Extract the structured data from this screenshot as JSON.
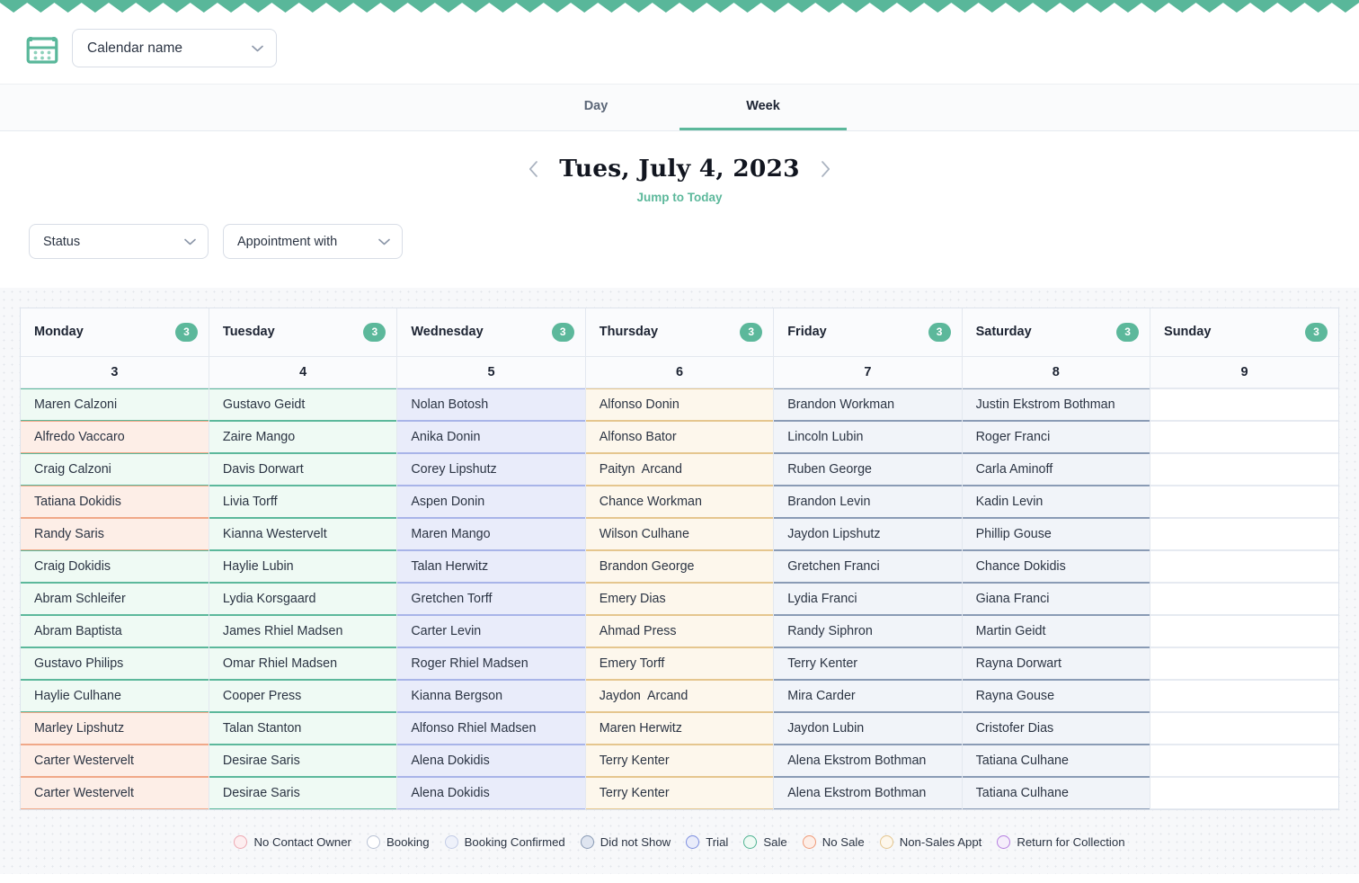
{
  "header": {
    "calendar_icon": "calendar-icon",
    "calendar_select_value": "Calendar name"
  },
  "tabs": [
    {
      "label": "Day",
      "active": false
    },
    {
      "label": "Week",
      "active": true
    }
  ],
  "date_nav": {
    "prev_icon": "chevron-left-icon",
    "next_icon": "chevron-right-icon",
    "title": "Tues, July 4, 2023",
    "jump_to_today": "Jump to Today"
  },
  "filters": [
    {
      "label": "Status",
      "name": "status"
    },
    {
      "label": "Appointment with",
      "name": "appointment-with"
    }
  ],
  "calendar": {
    "columns": [
      {
        "day": "Monday",
        "count": "3",
        "date": "3"
      },
      {
        "day": "Tuesday",
        "count": "3",
        "date": "4"
      },
      {
        "day": "Wednesday",
        "count": "3",
        "date": "5"
      },
      {
        "day": "Thursday",
        "count": "3",
        "date": "6"
      },
      {
        "day": "Friday",
        "count": "3",
        "date": "7"
      },
      {
        "day": "Saturday",
        "count": "3",
        "date": "8"
      },
      {
        "day": "Sunday",
        "count": "3",
        "date": "9"
      }
    ],
    "rows": [
      [
        {
          "name": "Maren Calzoni",
          "status": "sale"
        },
        {
          "name": "Gustavo Geidt",
          "status": "sale"
        },
        {
          "name": "Nolan Botosh",
          "status": "trial"
        },
        {
          "name": "Alfonso Donin",
          "status": "nonsales"
        },
        {
          "name": "Brandon Workman",
          "status": "didnotshow"
        },
        {
          "name": "Justin Ekstrom Bothman",
          "status": "didnotshow"
        },
        {
          "name": "",
          "status": "empty"
        }
      ],
      [
        {
          "name": "Alfredo Vaccaro",
          "status": "nosale"
        },
        {
          "name": "Zaire Mango",
          "status": "sale"
        },
        {
          "name": "Anika Donin",
          "status": "trial"
        },
        {
          "name": "Alfonso Bator",
          "status": "nonsales"
        },
        {
          "name": "Lincoln Lubin",
          "status": "didnotshow"
        },
        {
          "name": "Roger Franci",
          "status": "didnotshow"
        },
        {
          "name": "",
          "status": "empty"
        }
      ],
      [
        {
          "name": "Craig Calzoni",
          "status": "sale"
        },
        {
          "name": "Davis Dorwart",
          "status": "sale"
        },
        {
          "name": "Corey Lipshutz",
          "status": "trial"
        },
        {
          "name": "Paityn  Arcand",
          "status": "nonsales"
        },
        {
          "name": "Ruben George",
          "status": "didnotshow"
        },
        {
          "name": "Carla Aminoff",
          "status": "didnotshow"
        },
        {
          "name": "",
          "status": "empty"
        }
      ],
      [
        {
          "name": "Tatiana Dokidis",
          "status": "nosale"
        },
        {
          "name": "Livia Torff",
          "status": "sale"
        },
        {
          "name": "Aspen Donin",
          "status": "trial"
        },
        {
          "name": "Chance Workman",
          "status": "nonsales"
        },
        {
          "name": "Brandon Levin",
          "status": "didnotshow"
        },
        {
          "name": "Kadin Levin",
          "status": "didnotshow"
        },
        {
          "name": "",
          "status": "empty"
        }
      ],
      [
        {
          "name": "Randy Saris",
          "status": "nosale"
        },
        {
          "name": "Kianna Westervelt",
          "status": "sale"
        },
        {
          "name": "Maren Mango",
          "status": "trial"
        },
        {
          "name": "Wilson Culhane",
          "status": "nonsales"
        },
        {
          "name": "Jaydon Lipshutz",
          "status": "didnotshow"
        },
        {
          "name": "Phillip Gouse",
          "status": "didnotshow"
        },
        {
          "name": "",
          "status": "empty"
        }
      ],
      [
        {
          "name": "Craig Dokidis",
          "status": "sale"
        },
        {
          "name": "Haylie Lubin",
          "status": "sale"
        },
        {
          "name": "Talan Herwitz",
          "status": "trial"
        },
        {
          "name": "Brandon George",
          "status": "nonsales"
        },
        {
          "name": "Gretchen Franci",
          "status": "didnotshow"
        },
        {
          "name": "Chance Dokidis",
          "status": "didnotshow"
        },
        {
          "name": "",
          "status": "empty"
        }
      ],
      [
        {
          "name": "Abram Schleifer",
          "status": "sale"
        },
        {
          "name": "Lydia Korsgaard",
          "status": "sale"
        },
        {
          "name": "Gretchen Torff",
          "status": "trial"
        },
        {
          "name": "Emery Dias",
          "status": "nonsales"
        },
        {
          "name": "Lydia Franci",
          "status": "didnotshow"
        },
        {
          "name": "Giana Franci",
          "status": "didnotshow"
        },
        {
          "name": "",
          "status": "empty"
        }
      ],
      [
        {
          "name": "Abram Baptista",
          "status": "sale"
        },
        {
          "name": "James Rhiel Madsen",
          "status": "sale"
        },
        {
          "name": "Carter Levin",
          "status": "trial"
        },
        {
          "name": "Ahmad Press",
          "status": "nonsales"
        },
        {
          "name": "Randy Siphron",
          "status": "didnotshow"
        },
        {
          "name": "Martin Geidt",
          "status": "didnotshow"
        },
        {
          "name": "",
          "status": "empty"
        }
      ],
      [
        {
          "name": "Gustavo Philips",
          "status": "sale"
        },
        {
          "name": "Omar Rhiel Madsen",
          "status": "sale"
        },
        {
          "name": "Roger Rhiel Madsen",
          "status": "trial"
        },
        {
          "name": "Emery Torff",
          "status": "nonsales"
        },
        {
          "name": "Terry Kenter",
          "status": "didnotshow"
        },
        {
          "name": "Rayna Dorwart",
          "status": "didnotshow"
        },
        {
          "name": "",
          "status": "empty"
        }
      ],
      [
        {
          "name": "Haylie Culhane",
          "status": "sale"
        },
        {
          "name": "Cooper Press",
          "status": "sale"
        },
        {
          "name": "Kianna Bergson",
          "status": "trial"
        },
        {
          "name": "Jaydon  Arcand",
          "status": "nonsales"
        },
        {
          "name": "Mira Carder",
          "status": "didnotshow"
        },
        {
          "name": "Rayna Gouse",
          "status": "didnotshow"
        },
        {
          "name": "",
          "status": "empty"
        }
      ],
      [
        {
          "name": "Marley Lipshutz",
          "status": "nosale"
        },
        {
          "name": "Talan Stanton",
          "status": "sale"
        },
        {
          "name": "Alfonso Rhiel Madsen",
          "status": "trial"
        },
        {
          "name": "Maren Herwitz",
          "status": "nonsales"
        },
        {
          "name": "Jaydon Lubin",
          "status": "didnotshow"
        },
        {
          "name": "Cristofer Dias",
          "status": "didnotshow"
        },
        {
          "name": "",
          "status": "empty"
        }
      ],
      [
        {
          "name": "Carter Westervelt",
          "status": "nosale"
        },
        {
          "name": "Desirae Saris",
          "status": "sale"
        },
        {
          "name": "Alena Dokidis",
          "status": "trial"
        },
        {
          "name": "Terry Kenter",
          "status": "nonsales"
        },
        {
          "name": "Alena Ekstrom Bothman",
          "status": "didnotshow"
        },
        {
          "name": "Tatiana Culhane",
          "status": "didnotshow"
        },
        {
          "name": "",
          "status": "empty"
        }
      ],
      [
        {
          "name": "Carter Westervelt",
          "status": "nosale"
        },
        {
          "name": "Desirae Saris",
          "status": "sale"
        },
        {
          "name": "Alena Dokidis",
          "status": "trial"
        },
        {
          "name": "Terry Kenter",
          "status": "nonsales"
        },
        {
          "name": "Alena Ekstrom Bothman",
          "status": "didnotshow"
        },
        {
          "name": "Tatiana Culhane",
          "status": "didnotshow"
        },
        {
          "name": "",
          "status": "empty"
        }
      ]
    ]
  },
  "legend": [
    {
      "label": "No Contact Owner",
      "fill": "#fdeef0",
      "stroke": "#eda8b2"
    },
    {
      "label": "Booking",
      "fill": "#ffffff",
      "stroke": "#b9c2d4"
    },
    {
      "label": "Booking Confirmed",
      "fill": "#eef1fa",
      "stroke": "#c3cce6"
    },
    {
      "label": "Did not Show",
      "fill": "#dfe5f0",
      "stroke": "#8a9bb5"
    },
    {
      "label": "Trial",
      "fill": "#e9ecfa",
      "stroke": "#7d8fe0"
    },
    {
      "label": "Sale",
      "fill": "#effaf4",
      "stroke": "#4fb392"
    },
    {
      "label": "No Sale",
      "fill": "#fdeee7",
      "stroke": "#ef9a78"
    },
    {
      "label": "Non-Sales Appt",
      "fill": "#fdf7ec",
      "stroke": "#e5c68e"
    },
    {
      "label": "Return for Collection",
      "fill": "#f5eefb",
      "stroke": "#b57fe0"
    }
  ],
  "colors": {
    "brand_green": "#5cb89b",
    "text_dark": "#1d2433"
  }
}
